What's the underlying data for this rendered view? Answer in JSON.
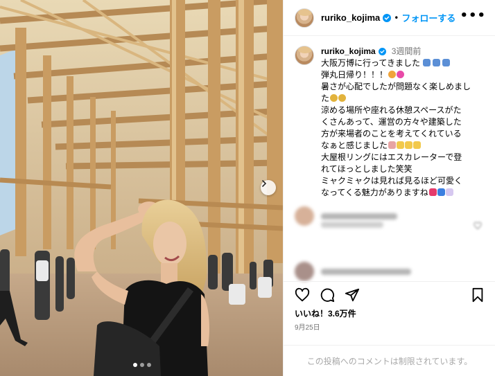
{
  "post": {
    "username": "ruriko_kojima",
    "follow_label": "フォローする",
    "dot_separator": "•",
    "more_label": "•••",
    "time_ago": "3週間前",
    "caption_lines": [
      "大阪万博に行ってきました",
      "弾丸日帰り！！！",
      "暑さが心配でしたが問題なく楽しめまし",
      "た",
      "涼める場所や座れる休憩スペースがた",
      "くさんあって、運営の方々や建築した",
      "方が来場者のことを考えてくれている",
      "なぁと感じました",
      "大屋根リングにはエスカレーターで登",
      "れてほっとしました笑笑",
      "ミャクミャクは見れば見るほど可愛く",
      "なってくる魅力がありますね"
    ],
    "likes_label": "いいね！3.6万件",
    "date": "9月25日",
    "comments_disabled_text": "この投稿へのコメントは制限されています。"
  },
  "photo": {
    "carousel_count": 3,
    "carousel_active_index": 0
  },
  "icons": {
    "more": "more-options-icon",
    "verified": "verified-badge-icon",
    "next": "chevron-right-icon",
    "like": "heart-icon",
    "comment": "comment-icon",
    "share": "share-icon",
    "save": "bookmark-icon"
  },
  "colors": {
    "accent": "#0095f6",
    "secondary_text": "#737373",
    "divider": "#efefef"
  }
}
